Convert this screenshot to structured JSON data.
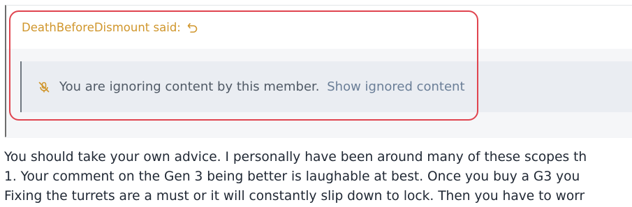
{
  "quote": {
    "author_label": "DeathBeforeDismount said:",
    "jump_icon": "undo-arrow-icon",
    "ignored_message": "You are ignoring content by this member.",
    "show_ignored_link": "Show ignored content",
    "mute_icon": "microphone-slash-icon"
  },
  "colors": {
    "author": "#d0962c",
    "highlight_border": "#e0444f",
    "ignored_bg": "#eaedf2",
    "link": "#6a7e97"
  },
  "post": {
    "lines": [
      "You should take your own advice. I personally have been around many of these scopes th",
      "1. Your comment on the Gen 3 being better is laughable at best. Once you buy a G3 you",
      "Fixing the turrets are a must or it will constantly slip down to lock. Then you have to worr"
    ]
  }
}
